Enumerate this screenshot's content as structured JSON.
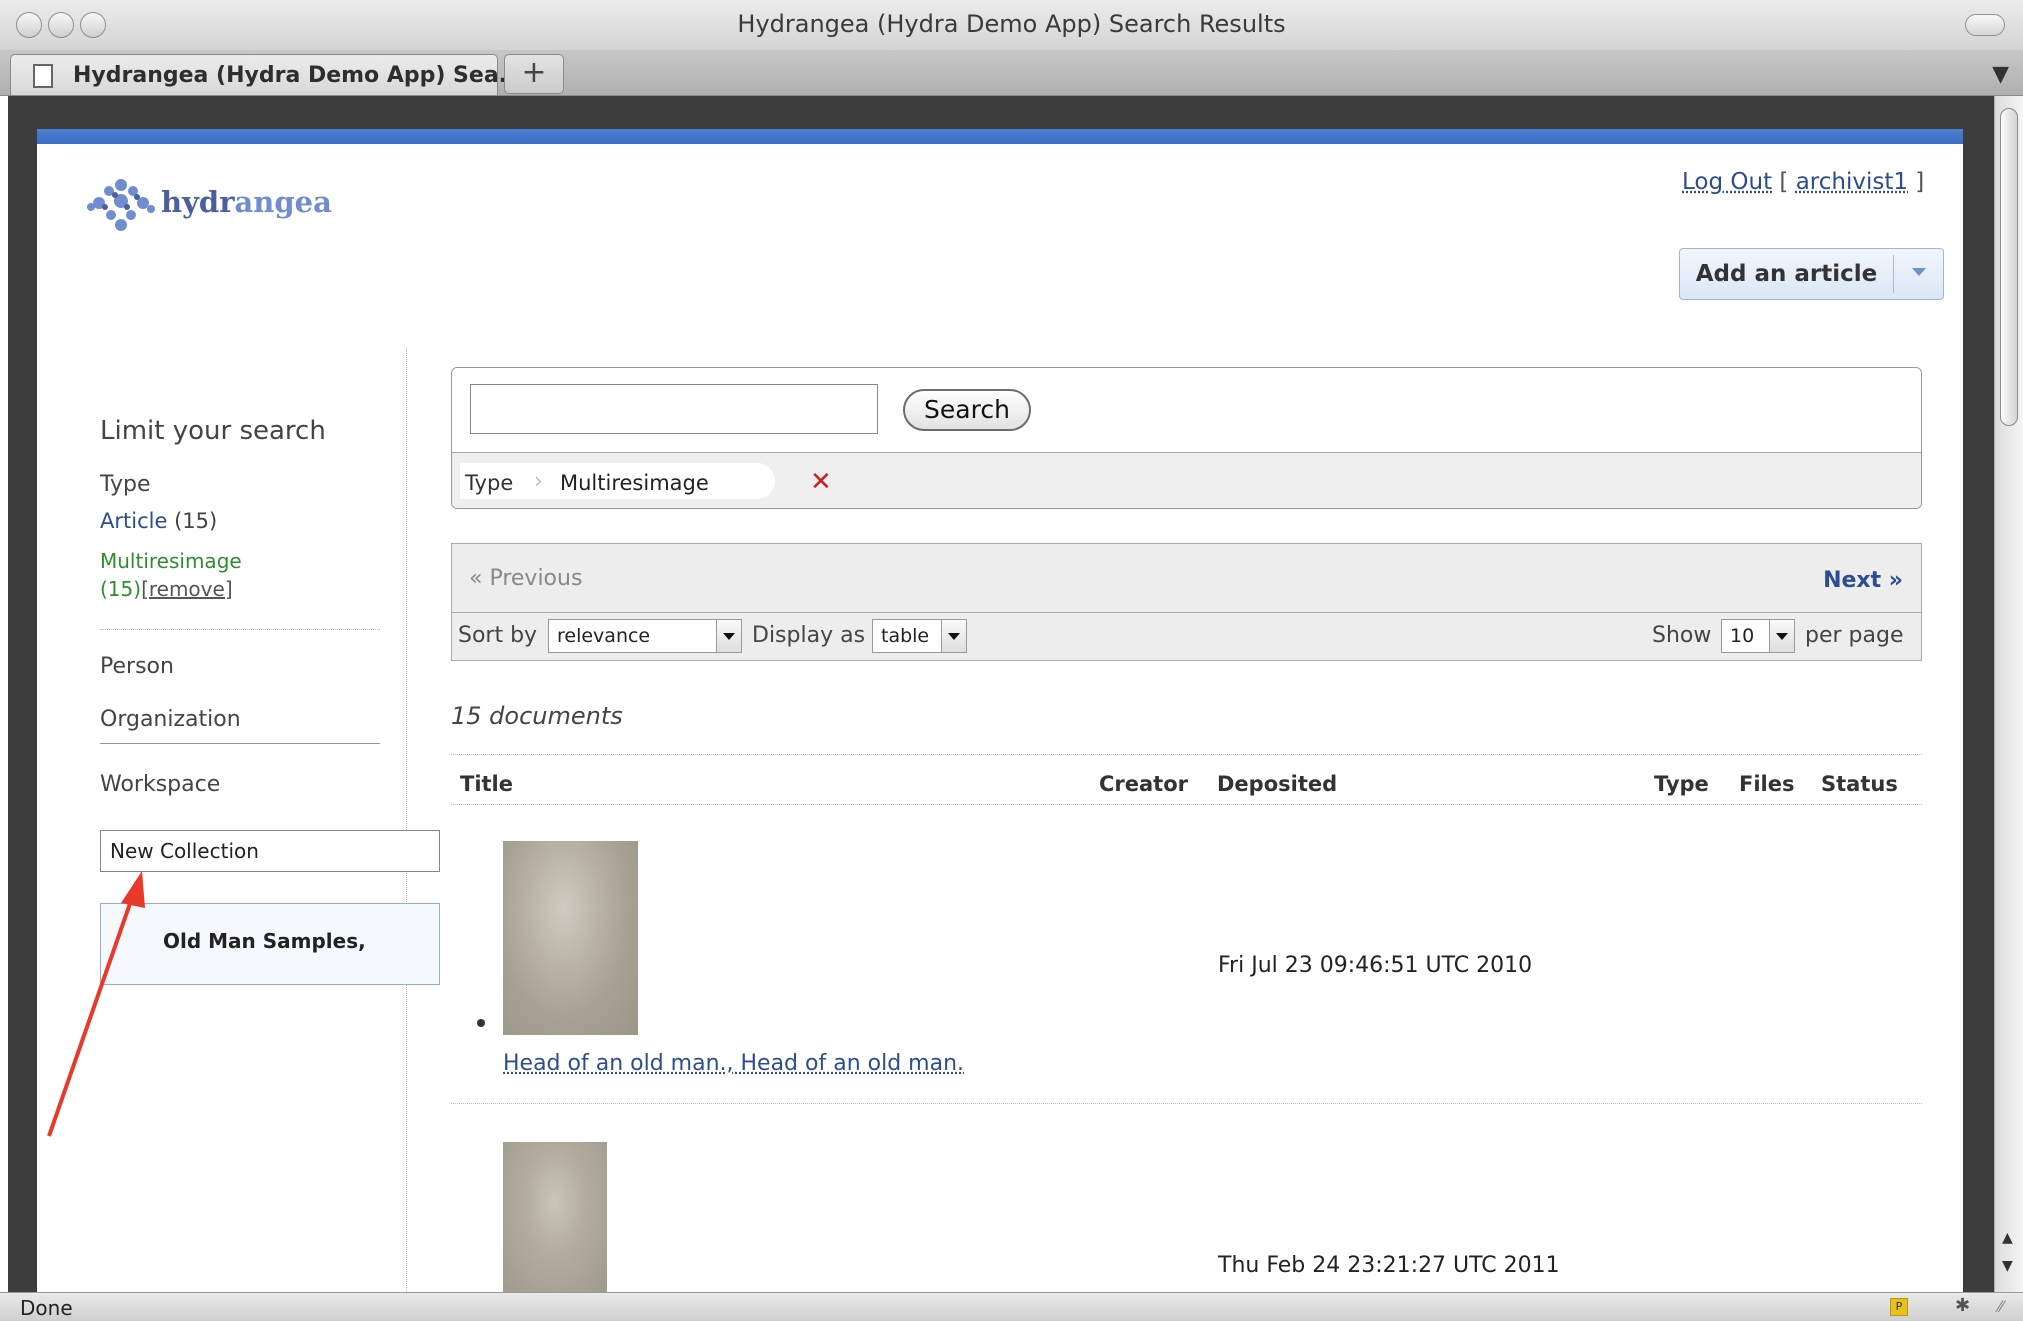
{
  "window": {
    "title": "Hydrangea (Hydra Demo App) Search Results"
  },
  "tabs": [
    {
      "label": "Hydrangea (Hydra Demo App) Sea..."
    }
  ],
  "tabstrip": {
    "new_tab_label": "+"
  },
  "header": {
    "logo_prefix": "hydr",
    "logo_suffix": "angea",
    "logout_label": "Log Out",
    "user_open": " [ ",
    "user_name": "archivist1",
    "user_close": " ]",
    "add_article_label": "Add an article"
  },
  "sidebar": {
    "heading": "Limit your search",
    "type_heading": "Type",
    "facets": [
      {
        "label": "Article",
        "count": "(15)"
      },
      {
        "label": "Multiresimage",
        "count": "(15)",
        "remove_label": "[remove]"
      }
    ],
    "person_heading": "Person",
    "organization_heading": "Organization",
    "workspace_heading": "Workspace",
    "new_collection_value": "New Collection",
    "collection_name": "Old Man Samples,"
  },
  "search": {
    "query": "",
    "button_label": "Search",
    "constraint_label": "Type",
    "constraint_separator": "›",
    "constraint_value": "Multiresimage",
    "remove_icon": "✕"
  },
  "pager": {
    "previous_label": "« Previous",
    "next_label": "Next »",
    "sort_label": "Sort by",
    "sort_value": "relevance",
    "display_label": "Display as",
    "display_value": "table",
    "show_label": "Show",
    "per_page_value": "10",
    "per_page_suffix": "per page"
  },
  "results": {
    "count_text": "15 documents",
    "columns": [
      "Title",
      "Creator",
      "Deposited",
      "Type",
      "Files",
      "Status"
    ],
    "rows": [
      {
        "title": "Head of an old man., Head of an old man.",
        "deposited": "Fri Jul 23 09:46:51 UTC 2010"
      },
      {
        "title": "",
        "deposited": "Thu Feb 24 23:21:27 UTC 2011"
      }
    ]
  },
  "status_bar": {
    "text": "Done",
    "plugin_icon_label": "P"
  },
  "colors": {
    "accent_blue": "#3a6ec6",
    "link": "#2c4d8f",
    "facet_selected": "#2d8f2d",
    "remove_red": "#cc1e1e",
    "annotation_arrow": "#e8392a"
  },
  "icons": [
    "document-icon",
    "tab-list-icon",
    "logo-flower-icon",
    "chevron-down-icon",
    "close-icon",
    "scroll-up-icon",
    "scroll-down-icon",
    "plugin-icon",
    "firebug-icon",
    "resize-grip-icon"
  ]
}
